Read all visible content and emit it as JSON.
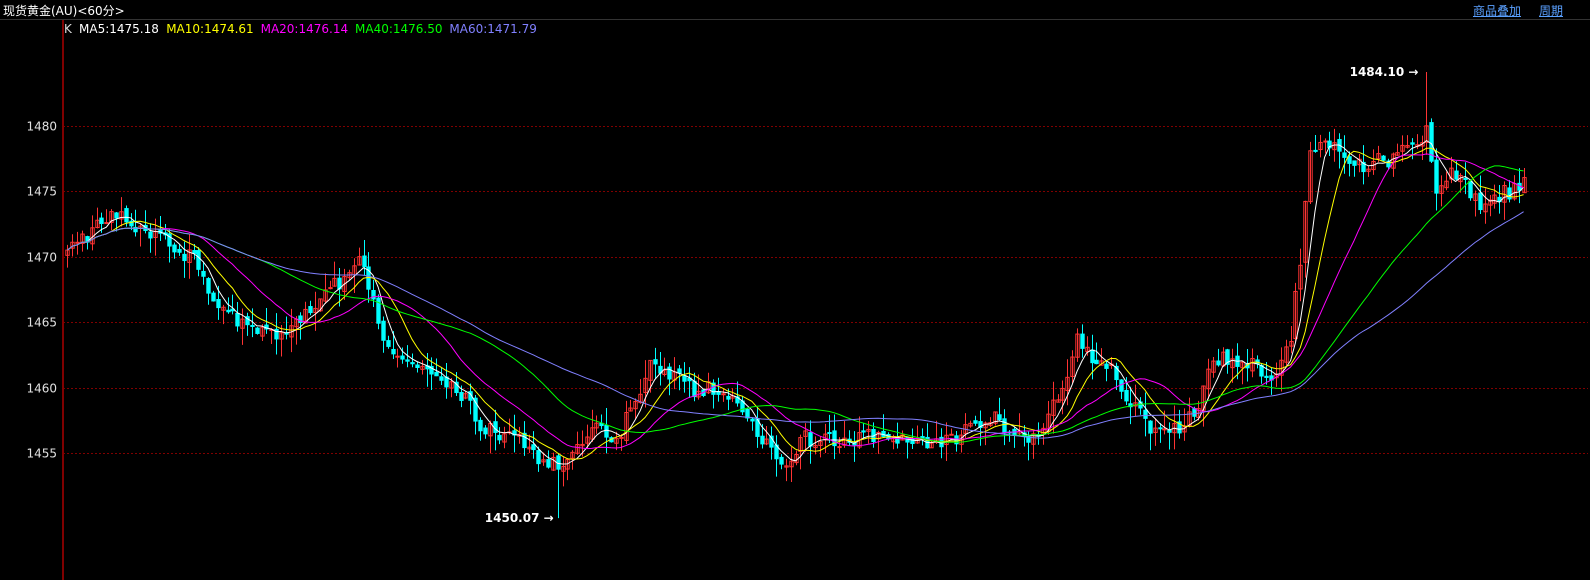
{
  "header": {
    "title": "现货黄金(AU)<60分>",
    "overlay_label": "商品叠加",
    "period_label": "周期"
  },
  "colors": {
    "up": "#ff3333",
    "down": "#00ffff",
    "ma5": "#ffffff",
    "ma10": "#ffff00",
    "ma20": "#ff00ff",
    "ma40": "#00ff00",
    "ma60": "#8080ff",
    "grid": "#800000",
    "axis": "#ff0000"
  },
  "chart_data": {
    "type": "candlestick",
    "legend_prefix": "K",
    "indicators": [
      {
        "key": "ma5",
        "label": "MA5:1475.18"
      },
      {
        "key": "ma10",
        "label": "MA10:1474.61"
      },
      {
        "key": "ma20",
        "label": "MA20:1476.14"
      },
      {
        "key": "ma40",
        "label": "MA40:1476.50"
      },
      {
        "key": "ma60",
        "label": "MA60:1471.79"
      }
    ],
    "y_ticks": [
      1455,
      1460,
      1465,
      1470,
      1475,
      1480
    ],
    "y_tick_labels": [
      "1455",
      "1460",
      "1465",
      "1470",
      "1475",
      "1480"
    ],
    "ylim": [
      1445.5,
      1487
    ],
    "grid": true,
    "high_label": "1484.10",
    "low_label": "1450.07",
    "high": 1484.1,
    "low": 1450.07,
    "anchors": [
      [
        0,
        1470.6
      ],
      [
        10,
        1473.5
      ],
      [
        18,
        1471.6
      ],
      [
        25,
        1470.2
      ],
      [
        32,
        1466.2
      ],
      [
        38,
        1464.5
      ],
      [
        44,
        1464.0
      ],
      [
        50,
        1466.0
      ],
      [
        55,
        1468.0
      ],
      [
        60,
        1469.5
      ],
      [
        62,
        1468.0
      ],
      [
        66,
        1463.0
      ],
      [
        72,
        1461.5
      ],
      [
        76,
        1460.5
      ],
      [
        82,
        1459.2
      ],
      [
        86,
        1457.0
      ],
      [
        92,
        1456.0
      ],
      [
        98,
        1454.4
      ],
      [
        103,
        1454.2
      ],
      [
        106,
        1455.8
      ],
      [
        110,
        1457.0
      ],
      [
        113,
        1456.0
      ],
      [
        116,
        1458.0
      ],
      [
        120,
        1461.8
      ],
      [
        124,
        1461.2
      ],
      [
        128,
        1460.0
      ],
      [
        134,
        1459.8
      ],
      [
        138,
        1459.0
      ],
      [
        142,
        1456.5
      ],
      [
        148,
        1454.5
      ],
      [
        152,
        1456.2
      ],
      [
        160,
        1456.0
      ],
      [
        168,
        1456.5
      ],
      [
        176,
        1455.8
      ],
      [
        182,
        1456.0
      ],
      [
        190,
        1457.8
      ],
      [
        196,
        1456.5
      ],
      [
        200,
        1456.0
      ],
      [
        204,
        1459.0
      ],
      [
        208,
        1463.5
      ],
      [
        214,
        1461.5
      ],
      [
        220,
        1459.0
      ],
      [
        224,
        1456.5
      ],
      [
        228,
        1457.0
      ],
      [
        232,
        1458.0
      ],
      [
        236,
        1462.3
      ],
      [
        242,
        1462.0
      ],
      [
        248,
        1461.0
      ],
      [
        252,
        1464.0
      ],
      [
        254,
        1469.5
      ],
      [
        256,
        1478.0
      ],
      [
        260,
        1478.7
      ],
      [
        266,
        1477.0
      ],
      [
        272,
        1477.5
      ],
      [
        277,
        1478.5
      ],
      [
        280,
        1479.5
      ],
      [
        282,
        1474.5
      ],
      [
        286,
        1476.5
      ],
      [
        292,
        1473.5
      ],
      [
        296,
        1474.8
      ],
      [
        300,
        1475.8
      ]
    ],
    "bar_count": 301
  }
}
